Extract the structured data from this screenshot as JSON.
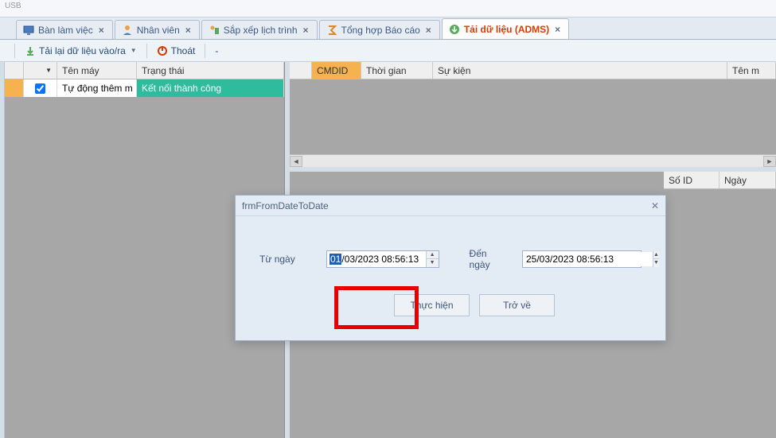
{
  "topStrip": "USB",
  "tabs": [
    {
      "label": "Bàn làm việc"
    },
    {
      "label": "Nhân viên"
    },
    {
      "label": "Sắp xếp lịch trình"
    },
    {
      "label": "Tổng hợp  Báo cáo"
    },
    {
      "label": "Tải dữ liệu (ADMS)",
      "active": true
    }
  ],
  "toolbar": {
    "reload": "Tải lại dữ liệu vào/ra",
    "logout": "Thoát"
  },
  "leftGrid": {
    "columns": {
      "name": "Tên máy",
      "status": "Trạng thái"
    },
    "rows": [
      {
        "checked": true,
        "name": "Tự động thêm m",
        "status": "Kết nối thành công"
      }
    ]
  },
  "rightUpper": {
    "columns": {
      "cmdid": "CMDID",
      "time": "Thời gian",
      "event": "Sự kiện",
      "machine": "Tên m"
    }
  },
  "rightLower": {
    "columns": {
      "id": "Số ID",
      "date": "Ngày"
    }
  },
  "dialog": {
    "title": "frmFromDateToDate",
    "fromLabel": "Từ ngày",
    "fromPrefix": "01",
    "fromRest": "/03/2023 08:56:13",
    "toLabel": "Đến ngày",
    "toValue": "25/03/2023 08:56:13",
    "execute": "Thực hiện",
    "back": "Trở về"
  }
}
